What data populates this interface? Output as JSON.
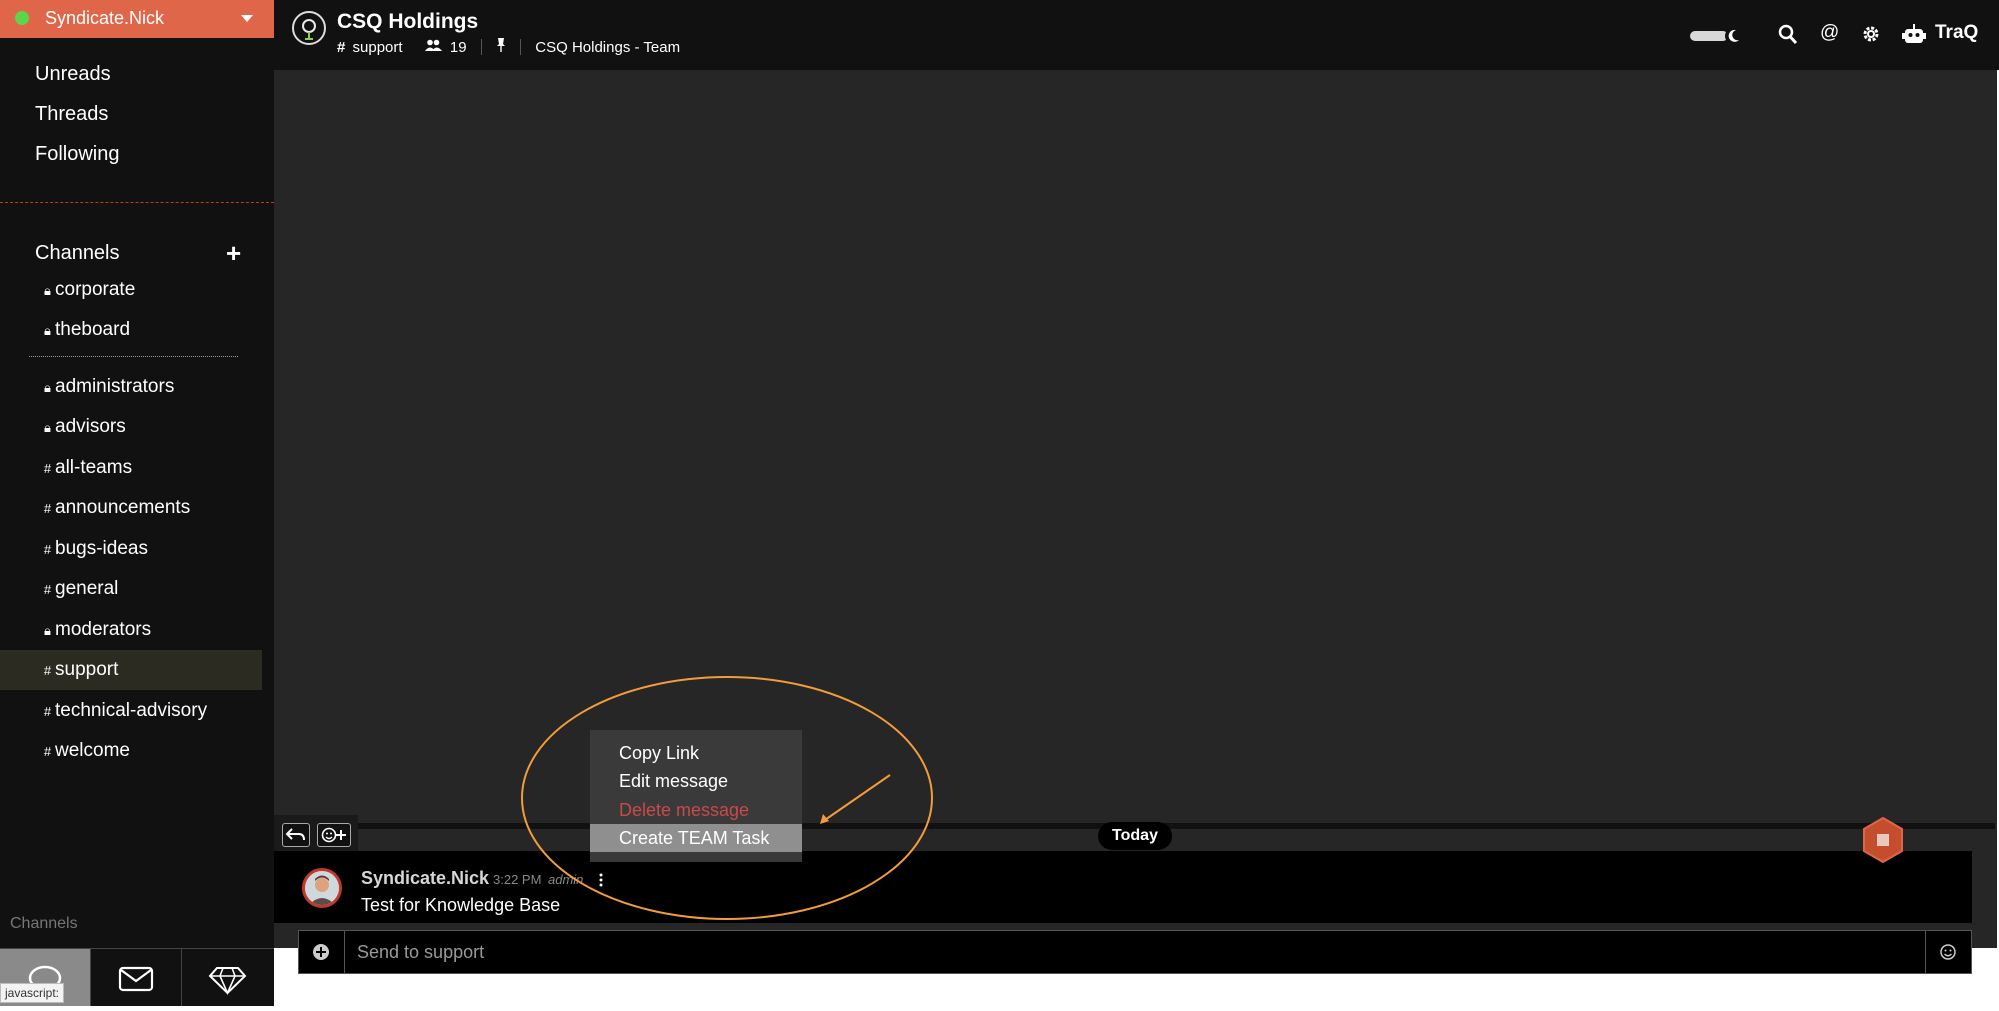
{
  "sidebar": {
    "user_name": "Syndicate.Nick",
    "nav": [
      "Unreads",
      "Threads",
      "Following"
    ],
    "channels_heading": "Channels",
    "pinned_channels": [
      {
        "name": "corporate",
        "private": true
      },
      {
        "name": "theboard",
        "private": true
      }
    ],
    "channels": [
      {
        "name": "administrators",
        "private": true
      },
      {
        "name": "advisors",
        "private": true
      },
      {
        "name": "all-teams",
        "private": false
      },
      {
        "name": "announcements",
        "private": false
      },
      {
        "name": "bugs-ideas",
        "private": false
      },
      {
        "name": "general",
        "private": false
      },
      {
        "name": "moderators",
        "private": true
      },
      {
        "name": "support",
        "private": false,
        "active": true
      },
      {
        "name": "technical-advisory",
        "private": false
      },
      {
        "name": "welcome",
        "private": false
      }
    ],
    "footer_label": "Channels",
    "tooltip": "javascript:"
  },
  "header": {
    "team_name": "CSQ Holdings",
    "channel": "support",
    "member_count": "19",
    "team_label": "CSQ Holdings - Team",
    "app_name": "TraQ"
  },
  "chat": {
    "date_divider": "Today",
    "message": {
      "author": "Syndicate.Nick",
      "time": "3:22 PM",
      "role": "admin",
      "text": "Test for Knowledge Base"
    }
  },
  "context_menu": {
    "items": [
      {
        "label": "Copy Link"
      },
      {
        "label": "Edit message"
      },
      {
        "label": "Delete message",
        "danger": true
      },
      {
        "label": "Create TEAM Task",
        "highlighted": true
      }
    ]
  },
  "composer": {
    "placeholder": "Send to support"
  },
  "colors": {
    "accent": "#e0664a",
    "status_online": "#5bd54a",
    "annotation": "#f39c3a",
    "danger": "#c94a48"
  },
  "icons": [
    "search-icon",
    "at-icon",
    "gear-icon",
    "robot-icon",
    "moon-icon",
    "reply-icon",
    "add-reaction-icon",
    "kebab-icon",
    "plus-circle-icon",
    "emoji-icon",
    "chat-icon",
    "mail-icon",
    "diamond-icon",
    "lock-icon",
    "hash-icon",
    "users-icon",
    "pin-icon"
  ]
}
